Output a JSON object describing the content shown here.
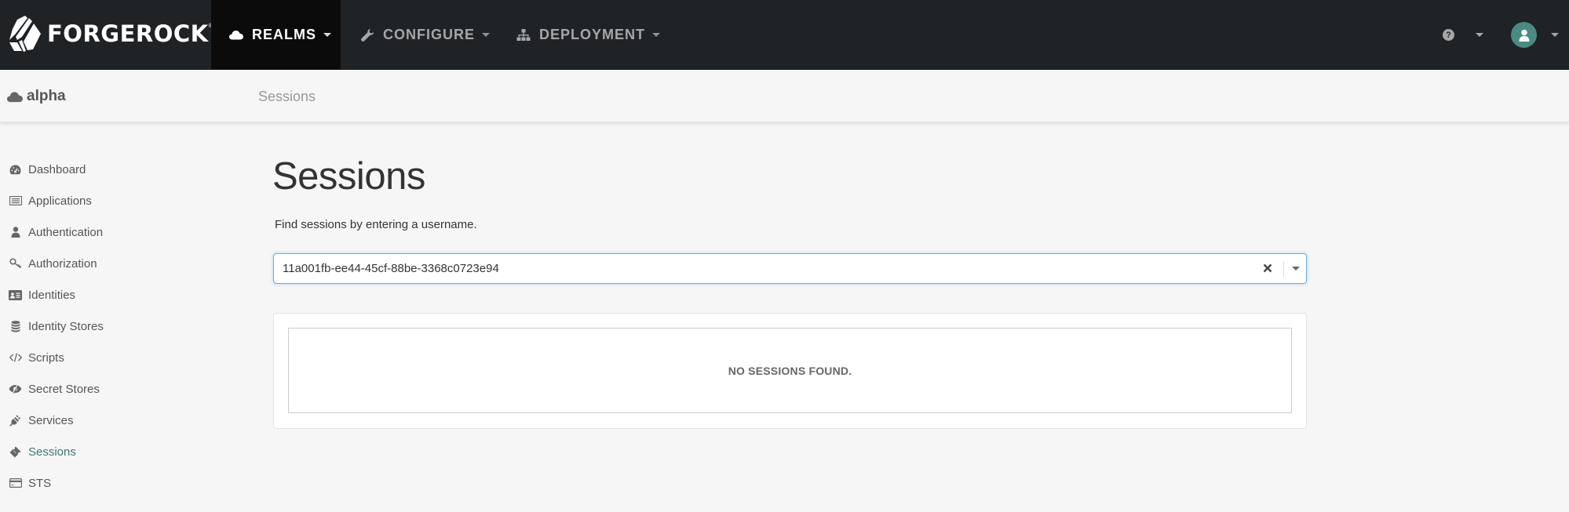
{
  "brand": {
    "name": "FORGEROCK",
    "registered_mark": "®"
  },
  "navbar": {
    "items": [
      {
        "label": "REALMS",
        "icon": "cloud-icon",
        "active": true
      },
      {
        "label": "CONFIGURE",
        "icon": "wrench-icon",
        "active": false
      },
      {
        "label": "DEPLOYMENT",
        "icon": "sitemap-icon",
        "active": false
      }
    ],
    "help_icon": "question-circle-icon",
    "help_glyph": "?",
    "user_icon": "user-avatar-icon",
    "accent_color": "#4a8a80"
  },
  "subheader": {
    "realm_name": "alpha",
    "realm_icon": "cloud-icon",
    "breadcrumb": "Sessions"
  },
  "sidebar": {
    "items": [
      {
        "label": "Dashboard",
        "icon": "dashboard-icon",
        "active": false
      },
      {
        "label": "Applications",
        "icon": "list-alt-icon",
        "active": false
      },
      {
        "label": "Authentication",
        "icon": "user-icon",
        "active": false
      },
      {
        "label": "Authorization",
        "icon": "key-icon",
        "active": false
      },
      {
        "label": "Identities",
        "icon": "id-card-icon",
        "active": false
      },
      {
        "label": "Identity Stores",
        "icon": "database-icon",
        "active": false
      },
      {
        "label": "Scripts",
        "icon": "code-icon",
        "active": false
      },
      {
        "label": "Secret Stores",
        "icon": "eye-slash-icon",
        "active": false
      },
      {
        "label": "Services",
        "icon": "plug-icon",
        "active": false
      },
      {
        "label": "Sessions",
        "icon": "ticket-icon",
        "active": true
      },
      {
        "label": "STS",
        "icon": "credit-card-icon",
        "active": false
      }
    ],
    "active_color": "#3b7a73"
  },
  "main": {
    "title": "Sessions",
    "hint": "Find sessions by entering a username.",
    "search": {
      "value": "11a001fb-ee44-45cf-88be-3368c0723e94",
      "placeholder": ""
    },
    "empty_message": "NO SESSIONS FOUND."
  }
}
